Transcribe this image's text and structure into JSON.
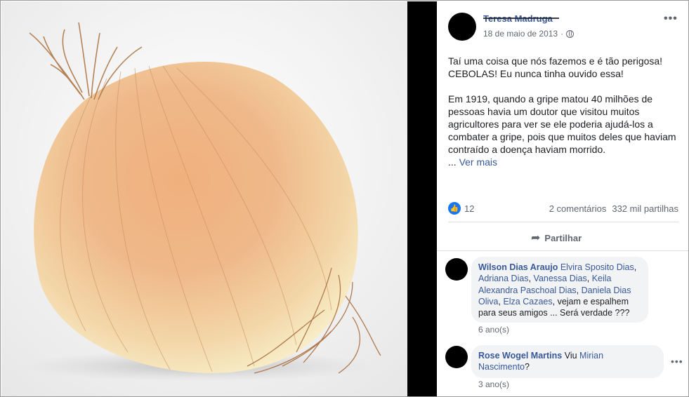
{
  "post": {
    "author": "Teresa Madruga",
    "date": "18 de maio de 2013",
    "privacy_icon": "globe-icon",
    "more_icon": "ellipsis-icon",
    "text_line1": "Taí uma coisa que nós fazemos e é tão perigosa!",
    "text_line2": "CEBOLAS! Eu nunca tinha ouvido essa!",
    "text_para2": "Em 1919, quando a gripe matou 40 milhões de pessoas havia um doutor que visitou muitos agricultores para ver se ele poderia ajudá-los a combater a gripe, pois que muitos deles que haviam contraído a doença haviam morrido.",
    "ellipsis": "...",
    "see_more": "Ver mais",
    "like_count": "12",
    "comments": "2 comentários",
    "shares": "332 mil partilhas",
    "share_label": "Partilhar"
  },
  "comment1": {
    "name": "Wilson Dias Araujo",
    "tag1": "Elvira Sposito Dias",
    "sep1": ", ",
    "tag2": "Adriana Dias",
    "sep2": ", ",
    "tag3": "Vanessa Dias",
    "sep3": ", ",
    "tag4": "Keila Alexandra Paschoal Dias",
    "sep4": ", ",
    "tag5": "Daniela Dias Oliva",
    "sep5": ", ",
    "tag6": "Elza Cazaes",
    "rest": ", vejam e espalhem para seus amigos ... Será verdade ???",
    "time": "6 ano(s)"
  },
  "comment2": {
    "name": "Rose Wogel Martins",
    "pre": "Viu",
    "tag1": "Mirian Nascimento",
    "post": "?",
    "time": "3 ano(s)"
  },
  "colors": {
    "link": "#385898",
    "like_blue": "#1877f2",
    "bubble": "#f2f3f5",
    "divider": "#000000"
  }
}
